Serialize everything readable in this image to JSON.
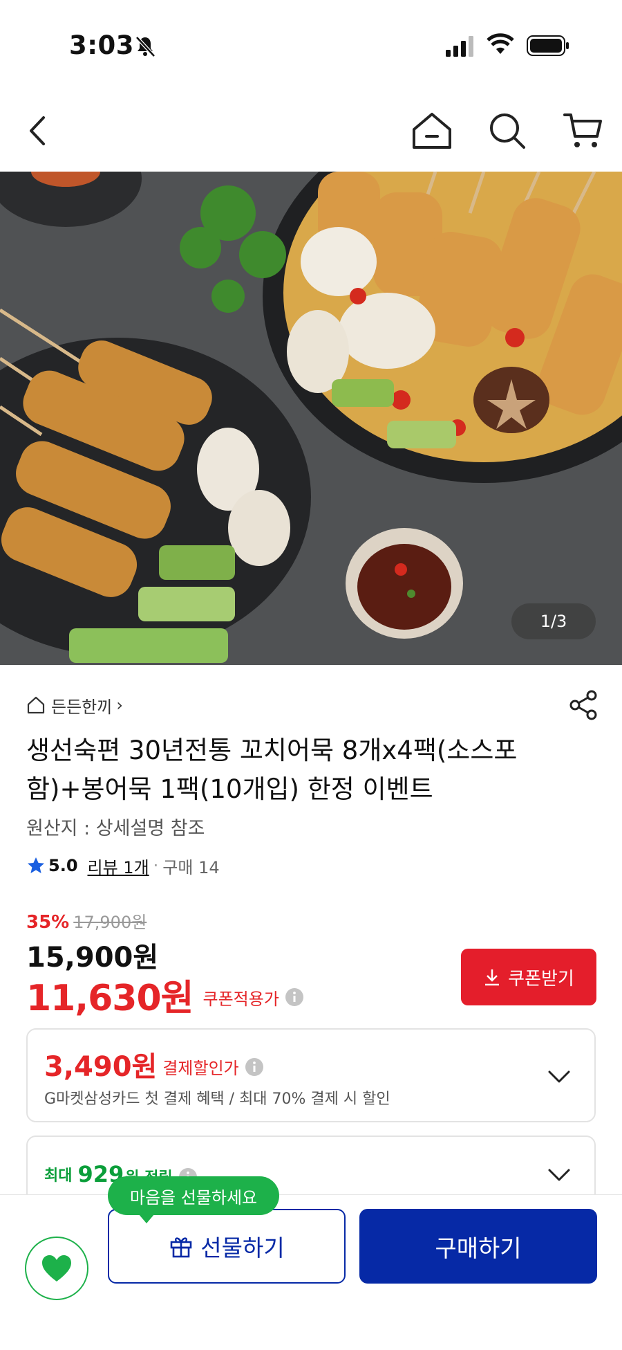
{
  "status_bar": {
    "time": "3:03"
  },
  "product": {
    "image_counter": "1/3",
    "breadcrumb": "든든한끼",
    "title": "생선숙편 30년전통 꼬치어묵 8개x4팩(소스포함)+봉어묵 1팩(10개입) 한정 이벤트",
    "origin": "원산지 : 상세설명 참조",
    "rating": "5.0",
    "review_link": "리뷰 1개",
    "purchase_count": "구매 14"
  },
  "price": {
    "discount_rate": "35%",
    "original_price": "17,900원",
    "sale_price": "15,900원",
    "coupon_price": "11,630원",
    "coupon_label": "쿠폰적용가",
    "coupon_button": "쿠폰받기"
  },
  "payment_discount": {
    "amount": "3,490원",
    "label": "결제할인가",
    "description": "G마켓삼성카드 첫 결제 혜택 / 최대 70% 결제 시 할인"
  },
  "savings": {
    "max_label": "최대",
    "amount": "929",
    "unit_label": "원 적립"
  },
  "bottom_bar": {
    "gift_tooltip": "마음을 선물하세요",
    "gift_button": "선물하기",
    "buy_button": "구매하기"
  },
  "colors": {
    "sale_red": "#e52528",
    "brand_blue": "#0629a6",
    "green": "#1db14a"
  }
}
